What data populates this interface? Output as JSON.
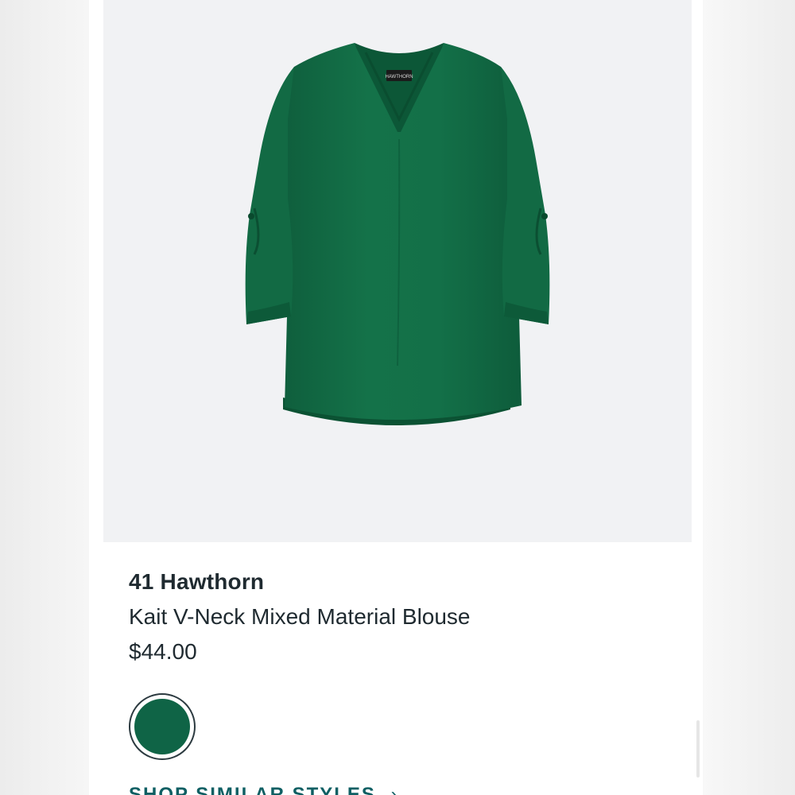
{
  "product": {
    "brand": "41 Hawthorn",
    "name": "Kait V-Neck Mixed Material Blouse",
    "price": "$44.00",
    "image_label": "HAWTHORN",
    "color_swatch": "#0f6446",
    "garment_color": "#137048",
    "shop_similar_label": "SHOP SIMILAR STYLES",
    "shop_similar_arrow": "›"
  },
  "colors": {
    "accent": "#0f5f63",
    "text": "#1f2a30",
    "image_bg": "#f1f2f4"
  }
}
